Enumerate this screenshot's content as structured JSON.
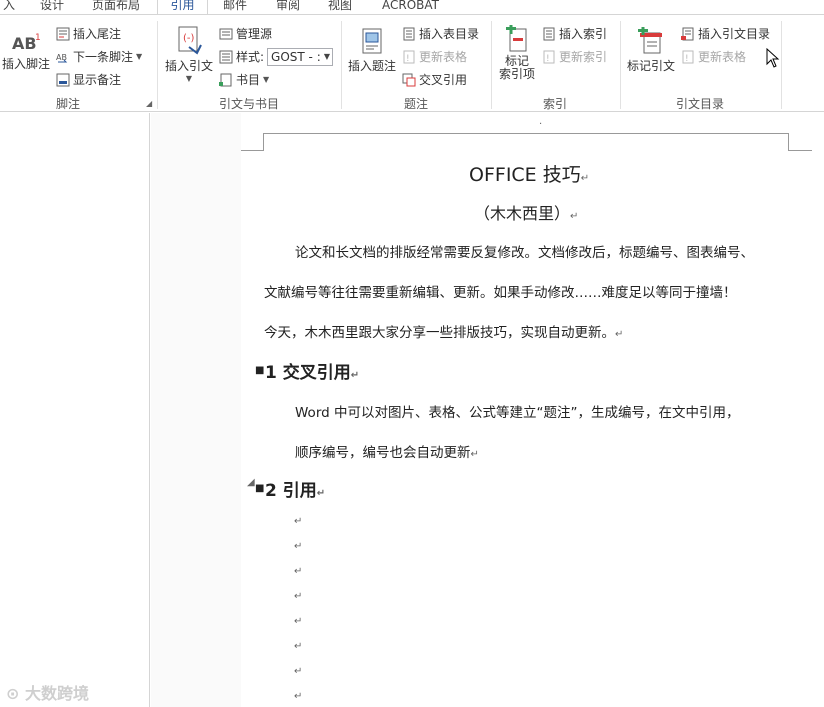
{
  "tabs": [
    "入",
    "设计",
    "页面布局",
    "引用",
    "邮件",
    "审阅",
    "视图",
    "ACROBAT"
  ],
  "ribbon": {
    "footnotes": {
      "insert_footnote": "插入脚注",
      "insert_endnote": "插入尾注",
      "next_footnote": "下一条脚注",
      "show_notes": "显示备注",
      "label": "脚注"
    },
    "citations": {
      "insert_citation": "插入引文",
      "manage_sources": "管理源",
      "style_label": "样式:",
      "style_value": "GOST - :",
      "bibliography": "书目",
      "label": "引文与书目"
    },
    "captions": {
      "insert_caption": "插入题注",
      "insert_table_of_figures": "插入表目录",
      "update_table": "更新表格",
      "cross_reference": "交叉引用",
      "label": "题注"
    },
    "index": {
      "mark_entry": "标记",
      "mark_entry_line2": "索引项",
      "insert_index": "插入索引",
      "update_index": "更新索引",
      "label": "索引"
    },
    "toa": {
      "mark_citation": "标记引文",
      "insert_toa": "插入引文目录",
      "update_table": "更新表格",
      "label": "引文目录"
    }
  },
  "document": {
    "title": "OFFICE 技巧",
    "subtitle": "（木木西里）",
    "para1_line1": "论文和长文档的排版经常需要反复修改。文档修改后，标题编号、图表编号、",
    "para1_line2": "文献编号等往往需要重新编辑、更新。如果手动修改……难度足以等同于撞墙！",
    "para1_line3": "今天，木木西里跟大家分享一些排版技巧，实现自动更新。",
    "h1": "1 交叉引用",
    "para2_line1": "Word 中可以对图片、表格、公式等建立“题注”，生成编号，在文中引用，",
    "para2_line2": "顺序编号，编号也会自动更新",
    "h2": "2 引用",
    "para_mark": "↵"
  },
  "watermark": "大数跨境",
  "colors": {
    "accent": "#2b579a",
    "disabled": "#a6a6a6",
    "icon_green": "#3a9e5b",
    "icon_red": "#d83b3b"
  }
}
